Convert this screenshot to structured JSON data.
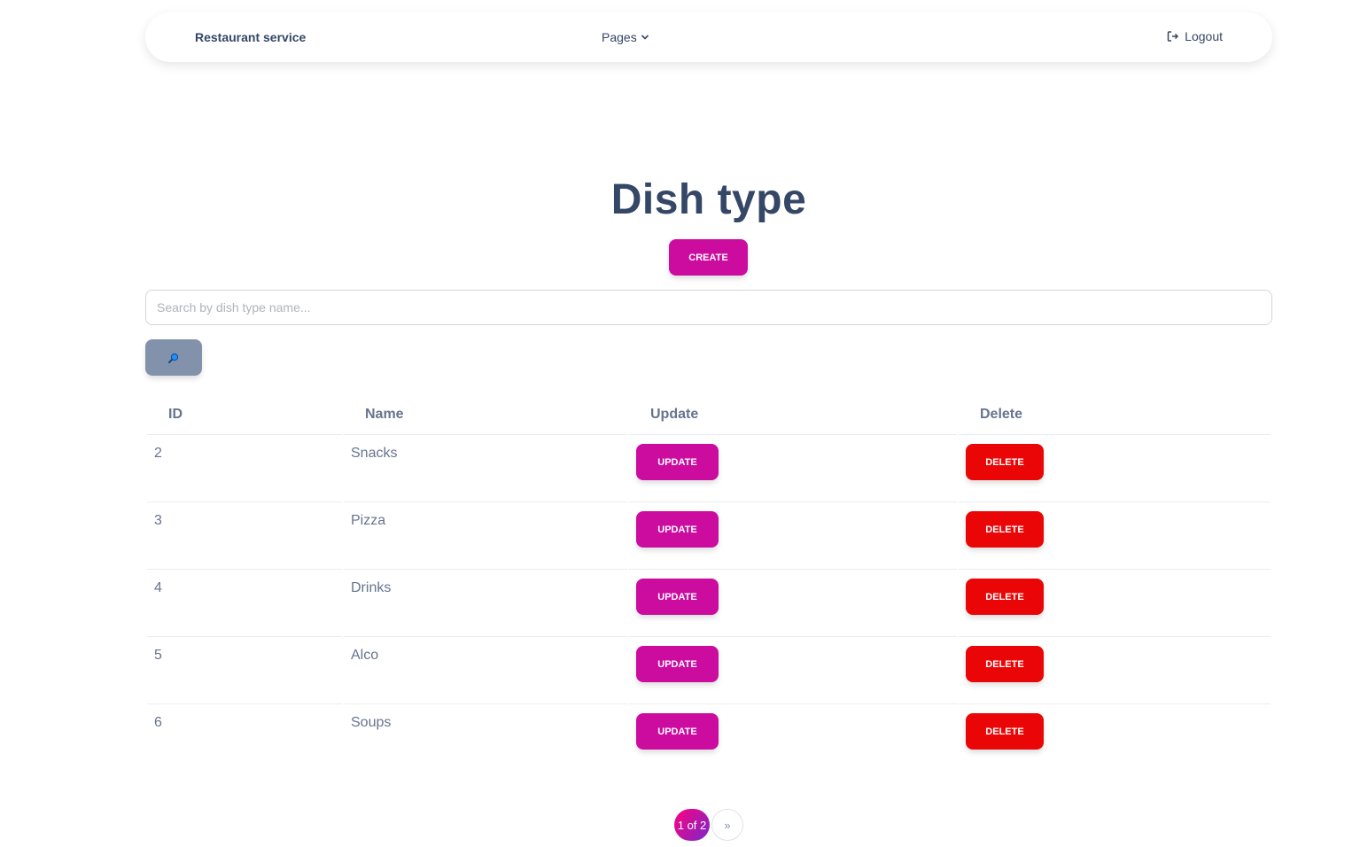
{
  "navbar": {
    "brand": "Restaurant service",
    "pages_label": "Pages",
    "logout_label": "Logout"
  },
  "page": {
    "title": "Dish type",
    "create_label": "CREATE"
  },
  "search": {
    "placeholder": "Search by dish type name..."
  },
  "table": {
    "headers": {
      "id": "ID",
      "name": "Name",
      "update": "Update",
      "delete": "Delete"
    },
    "update_label": "UPDATE",
    "delete_label": "DELETE",
    "rows": [
      {
        "id": "2",
        "name": "Snacks"
      },
      {
        "id": "3",
        "name": "Pizza"
      },
      {
        "id": "4",
        "name": "Drinks"
      },
      {
        "id": "5",
        "name": "Alco"
      },
      {
        "id": "6",
        "name": "Soups"
      }
    ]
  },
  "pagination": {
    "current": "1 of 2",
    "next": "»"
  },
  "colors": {
    "primary": "#cb0c9f",
    "danger": "#ea0606",
    "secondary": "#8392ab",
    "text": "#344767"
  }
}
